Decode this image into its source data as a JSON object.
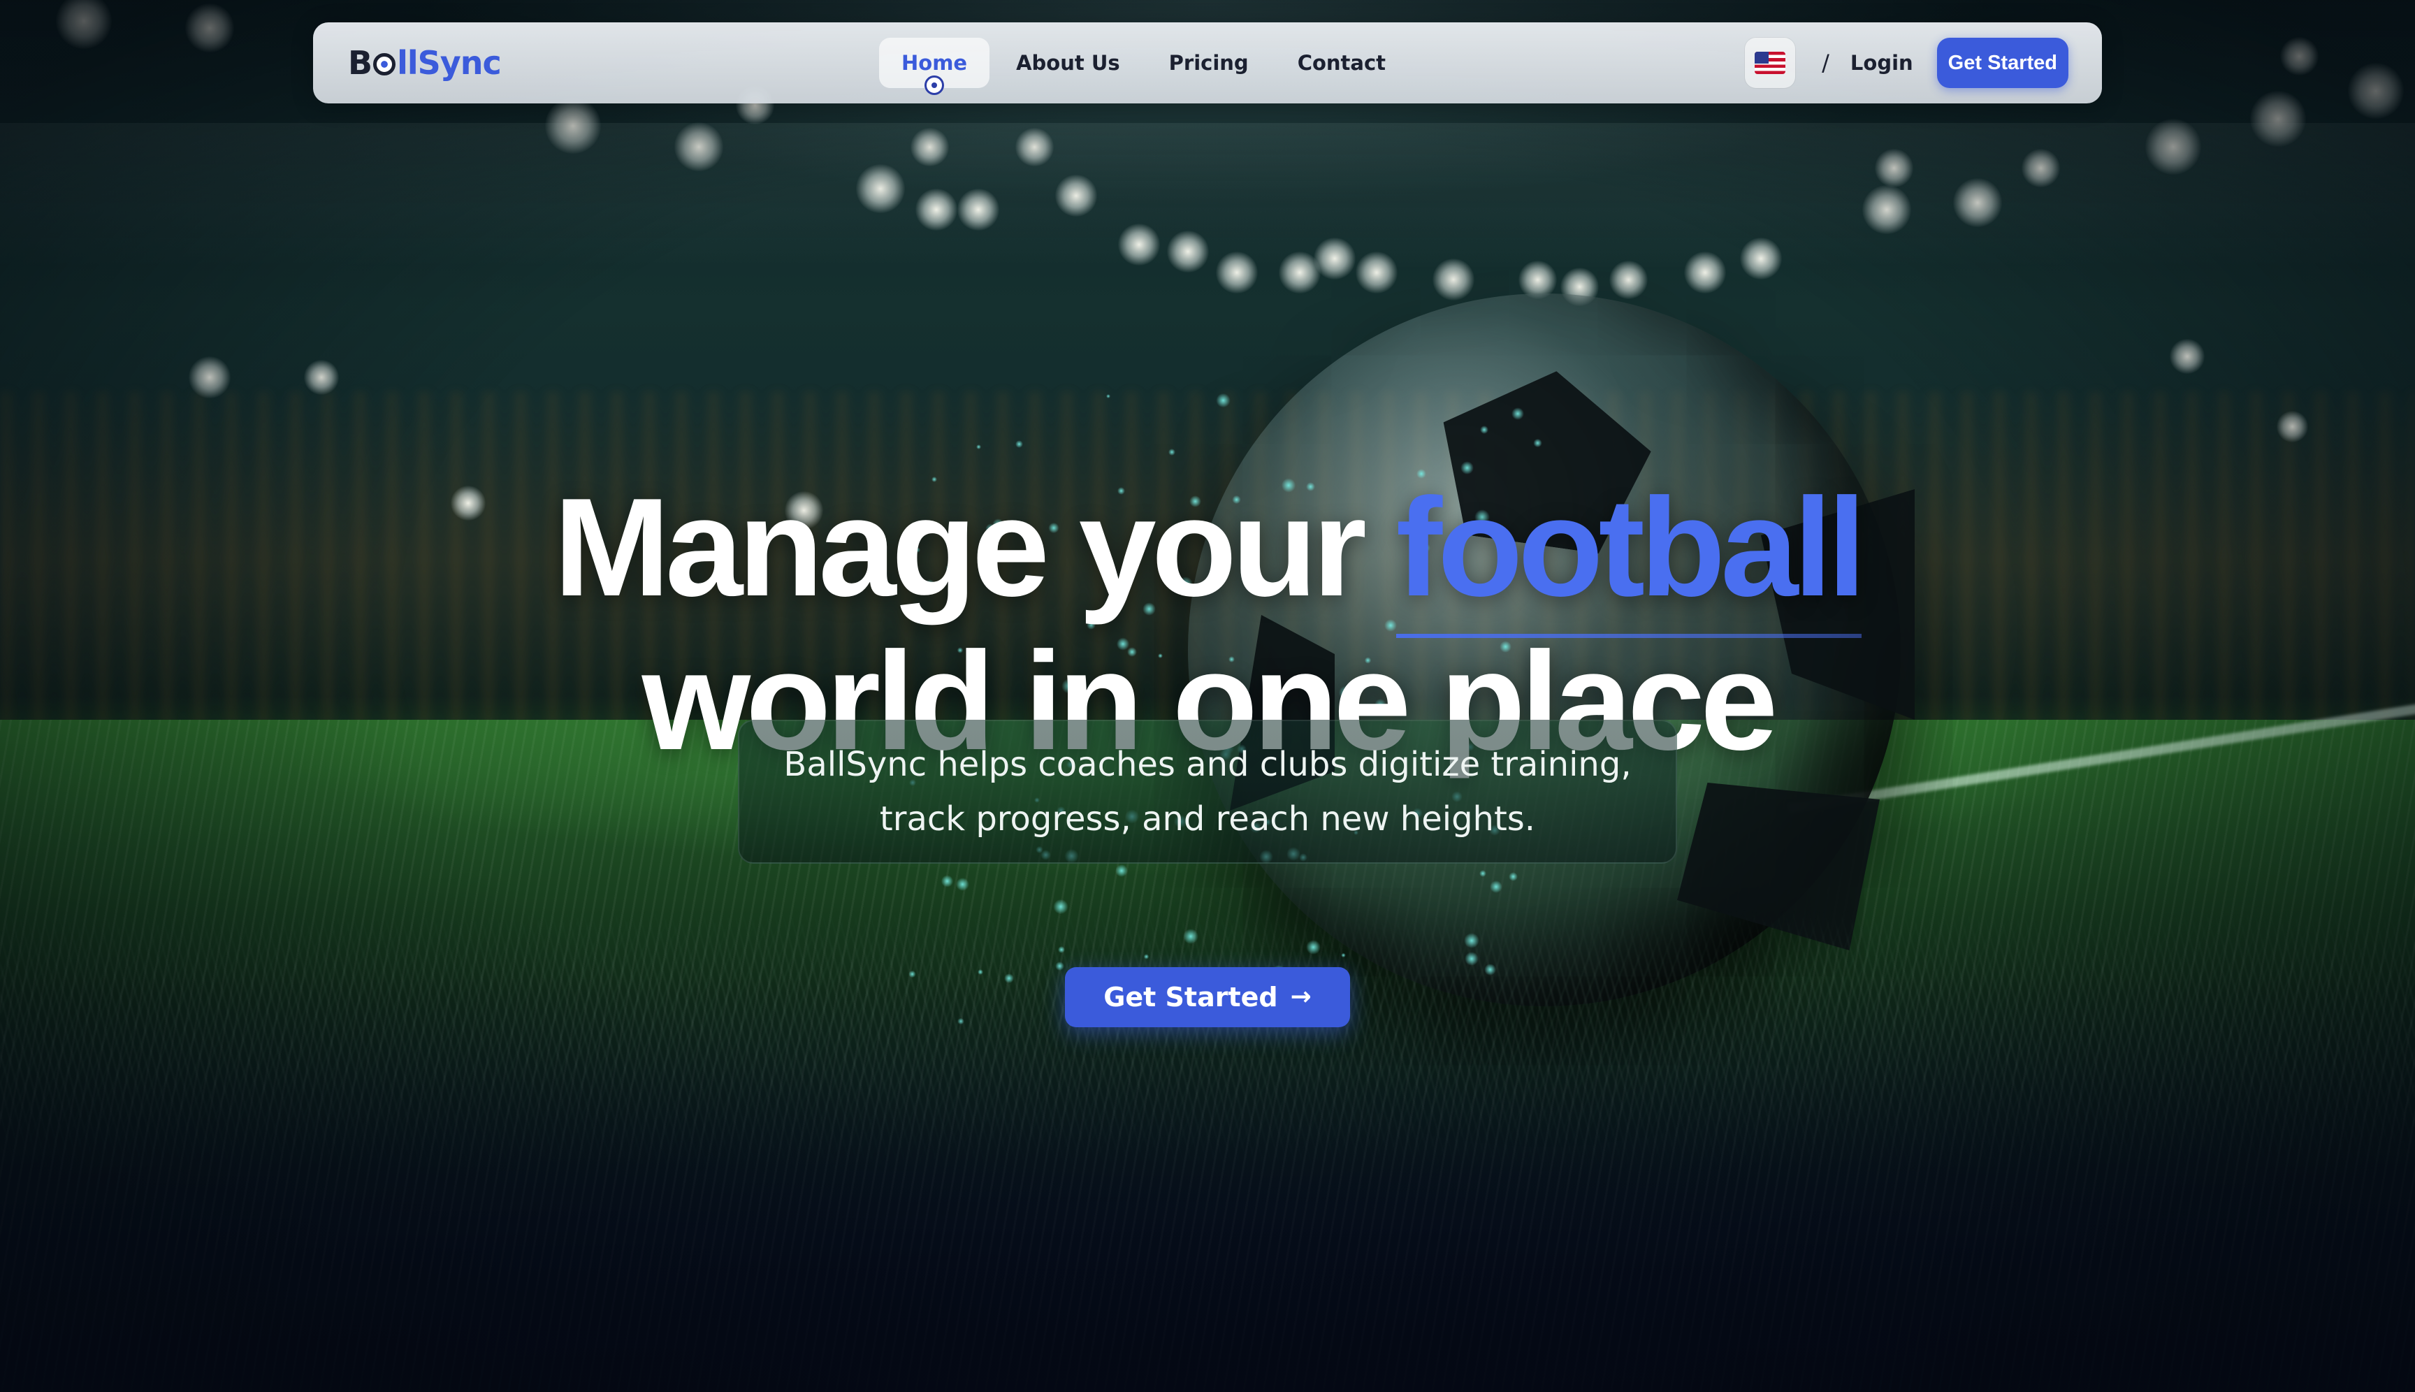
{
  "navbar": {
    "logo": {
      "first": "B",
      "rest": "llSync"
    },
    "links": [
      {
        "label": "Home",
        "active": true
      },
      {
        "label": "About Us",
        "active": false
      },
      {
        "label": "Pricing",
        "active": false
      },
      {
        "label": "Contact",
        "active": false
      }
    ],
    "language_flag": "us-flag-icon",
    "separator": "/",
    "login_label": "Login",
    "cta_label": "Get Started"
  },
  "hero": {
    "title_part1": "Manage your ",
    "title_accent": "football",
    "title_line2": "world in one place",
    "subtitle_line1": "BallSync helps coaches and clubs digitize training,",
    "subtitle_line2": "track progress, and reach new heights.",
    "cta_label": "Get Started",
    "cta_icon": "→"
  },
  "colors": {
    "accent": "#3b5bdb",
    "title_accent": "#4a6ff0",
    "dark_text": "#1b2030"
  }
}
